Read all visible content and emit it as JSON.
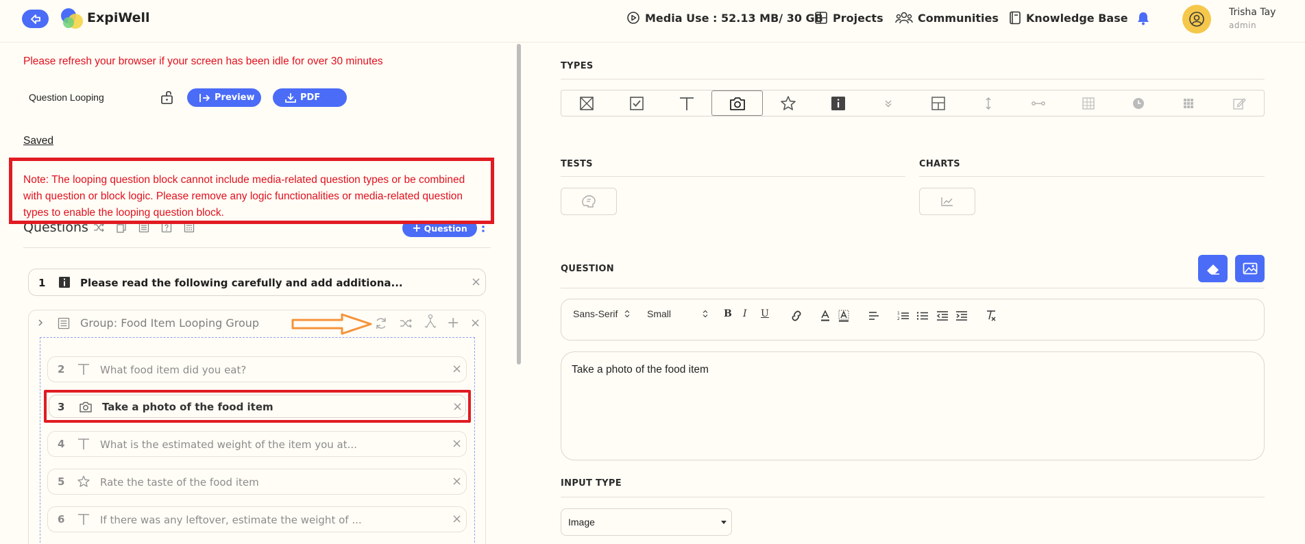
{
  "header": {
    "brand": "ExpiWell",
    "media_use": "Media Use : 52.13 MB/ 30 GB",
    "nav": {
      "projects": "Projects",
      "communities": "Communities",
      "knowledge_base": "Knowledge Base"
    },
    "user": {
      "name": "Trisha Tay",
      "role": "admin"
    },
    "icons": [
      "back-icon",
      "play-circle-icon",
      "grid-icon",
      "people-icon",
      "book-icon",
      "bell-icon",
      "user-circle-icon"
    ]
  },
  "left": {
    "refresh_note": "Please refresh your browser if your screen has been idle for over 30 minutes",
    "section_label": "Question Looping",
    "preview_label": "Preview",
    "pdf_label": "PDF",
    "saved_label": "Saved",
    "note": "Note: The looping question block cannot include media-related question types or be combined with question or block logic. Please remove any logic functionalities or media-related question types to enable the looping question block.",
    "questions_title": "Questions",
    "add_question_label": "Question",
    "first_question": {
      "num": "1",
      "icon": "info-icon",
      "text": "Please read the following carefully and add additiona..."
    },
    "group": {
      "label": "Group: Food Item Looping Group"
    },
    "group_questions": [
      {
        "num": "2",
        "icon": "text-icon",
        "text": "What food item did you eat?"
      },
      {
        "num": "3",
        "icon": "camera-icon",
        "text": "Take a photo of the food item"
      },
      {
        "num": "4",
        "icon": "text-icon",
        "text": "What is the estimated weight of the item you at..."
      },
      {
        "num": "5",
        "icon": "star-icon",
        "text": "Rate the taste of the food item"
      },
      {
        "num": "6",
        "icon": "text-icon",
        "text": "If there was any leftover, estimate the weight of ..."
      }
    ]
  },
  "right": {
    "types_label": "TYPES",
    "tests_label": "TESTS",
    "charts_label": "CHARTS",
    "question_label": "QUESTION",
    "toolbar": {
      "font": "Sans-Serif",
      "size": "Small"
    },
    "question_text": "Take a photo of the food item",
    "input_type_label": "INPUT TYPE",
    "input_type_value": "Image"
  },
  "colors": {
    "accent": "#4a6cf7",
    "alert": "#e11b22",
    "highlight_arrow": "#f5933b"
  }
}
